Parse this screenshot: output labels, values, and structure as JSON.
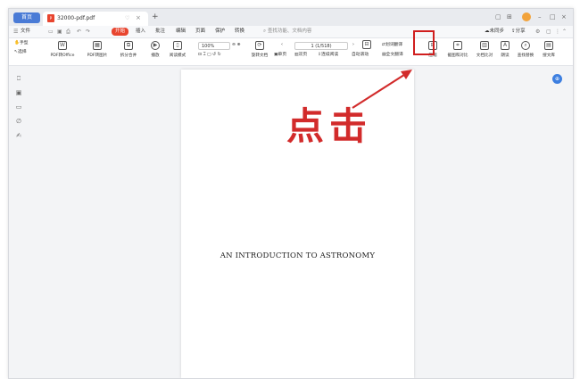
{
  "titlebar": {
    "home_tab": "首页",
    "doc_tab": "32000-pdf.pdf",
    "pdf_badge": "P",
    "close_glyph": "×",
    "fav_glyph": "♡",
    "add_glyph": "+",
    "win_controls": [
      "▢",
      "⊞",
      "–",
      "□",
      "×"
    ]
  },
  "menubar": {
    "file": "文件",
    "items": [
      "开始",
      "插入",
      "批注",
      "编辑",
      "页面",
      "保护",
      "转换"
    ],
    "active_index": 0,
    "search_placeholder": "查找功能、文档内容",
    "right_items": [
      "未同步",
      "分享"
    ]
  },
  "ribbon": {
    "hand_tool": "手型",
    "select_tool": "选择",
    "tools_left": [
      "PDF转Office",
      "PDF转图片",
      "拆分合并",
      "播放",
      "阅读模式"
    ],
    "zoom": "100%",
    "rotate": "旋转文档",
    "single_page": "单页",
    "double_page": "双页",
    "continuous": "连续阅读",
    "auto_scroll": "自动滚动",
    "page_indicator": "1 (1/518)",
    "translate_select": "划词翻译",
    "translate_full": "全文翻译",
    "tools_right": [
      "压缩",
      "截图和对比",
      "文档比对",
      "朗读",
      "查找替换",
      "搜文库"
    ]
  },
  "document": {
    "title": "AN INTRODUCTION TO ASTRONOMY"
  },
  "annotation": {
    "text": "点击",
    "color": "#d22b2b"
  },
  "colors": {
    "accent": "#e8452f",
    "home_tab": "#4a7bd6"
  }
}
